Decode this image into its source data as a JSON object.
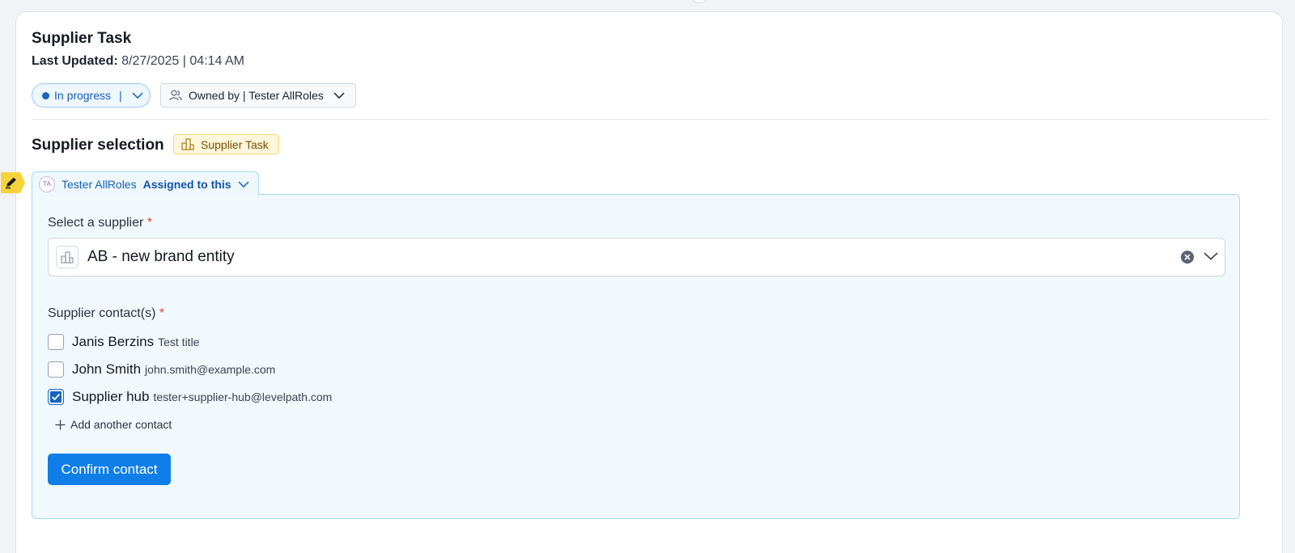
{
  "task": {
    "title": "Supplier Task",
    "last_updated_label": "Last Updated:",
    "last_updated_value": "8/27/2025 | 04:14 AM"
  },
  "status": {
    "label": "In progress",
    "separator": "|",
    "color": "#1565c0"
  },
  "owner": {
    "label": "Owned by | Tester AllRoles",
    "icon": "users-icon"
  },
  "section": {
    "title": "Supplier selection",
    "badge_label": "Supplier Task",
    "badge_icon": "building-icon"
  },
  "assignee": {
    "initials": "TA",
    "name": "Tester AllRoles",
    "assigned_label": "Assigned to this",
    "edit_icon": "pencil-icon"
  },
  "supplier_field": {
    "label": "Select a supplier",
    "required_mark": "*",
    "value": "AB - new brand entity",
    "icon": "building-icon"
  },
  "contacts": {
    "label": "Supplier contact(s)",
    "required_mark": "*",
    "items": [
      {
        "name": "Janis Berzins",
        "detail": "Test title",
        "checked": false
      },
      {
        "name": "John Smith",
        "detail": "john.smith@example.com",
        "checked": false
      },
      {
        "name": "Supplier hub",
        "detail": "tester+supplier-hub@levelpath.com",
        "checked": true
      }
    ],
    "add_label": "Add another contact"
  },
  "actions": {
    "confirm_label": "Confirm contact"
  },
  "colors": {
    "primary": "#0f7ee8",
    "accent_text": "#1560b8",
    "badge_bg": "#fff7dc",
    "panel_bg": "#f1f9fd",
    "required": "#e0452c"
  }
}
